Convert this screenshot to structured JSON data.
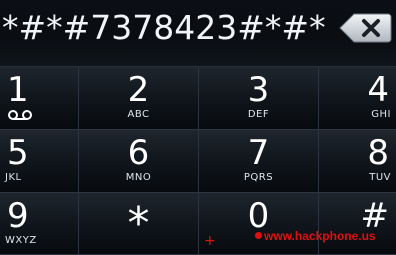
{
  "display": {
    "number": "*#*#7378423#*#*"
  },
  "delete_button": {
    "icon": "backspace-x-icon"
  },
  "keys": [
    {
      "digit": "1",
      "letters": "",
      "icon": "voicemail-icon"
    },
    {
      "digit": "2",
      "letters": "ABC"
    },
    {
      "digit": "3",
      "letters": "DEF"
    },
    {
      "digit": "4",
      "letters": "GHI"
    },
    {
      "digit": "5",
      "letters": "JKL"
    },
    {
      "digit": "6",
      "letters": "MNO"
    },
    {
      "digit": "7",
      "letters": "PQRS"
    },
    {
      "digit": "8",
      "letters": "TUV"
    },
    {
      "digit": "9",
      "letters": "WXYZ"
    },
    {
      "digit": "*",
      "letters": ""
    },
    {
      "digit": "0",
      "letters": "+"
    },
    {
      "digit": "#",
      "letters": ""
    }
  ],
  "watermark": {
    "text": "www.hackphone.us",
    "color": "#e01010"
  }
}
